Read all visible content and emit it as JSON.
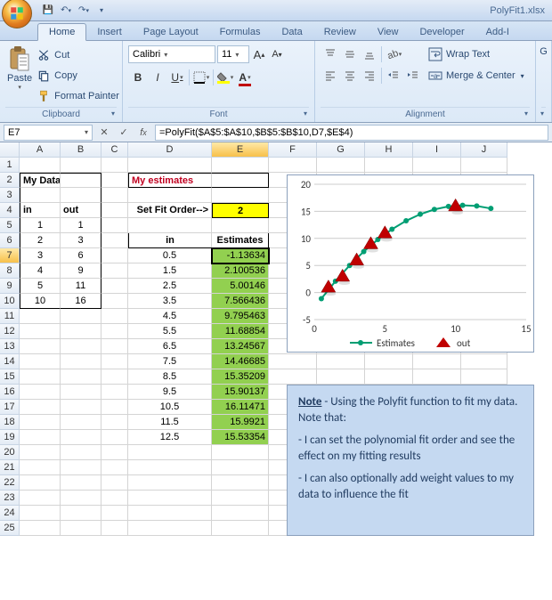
{
  "window": {
    "title": "PolyFit1.xlsx"
  },
  "qat": {
    "save": "💾",
    "undo": "↶",
    "redo": "↷"
  },
  "tabs": [
    "Home",
    "Insert",
    "Page Layout",
    "Formulas",
    "Data",
    "Review",
    "View",
    "Developer",
    "Add-I"
  ],
  "ribbon": {
    "clipboard": {
      "paste": "Paste",
      "cut": "Cut",
      "copy": "Copy",
      "format_painter": "Format Painter",
      "label": "Clipboard"
    },
    "font": {
      "name": "Calibri",
      "size": "11",
      "bold": "B",
      "italic": "I",
      "underline": "U",
      "grow": "A",
      "shrink": "A",
      "label": "Font"
    },
    "alignment": {
      "wrap": "Wrap Text",
      "merge": "Merge & Center",
      "label": "Alignment"
    }
  },
  "namebox": "E7",
  "formula": "=PolyFit($A$5:$A$10,$B$5:$B$10,D7,$E$4)",
  "columns": [
    "A",
    "B",
    "C",
    "D",
    "E",
    "F",
    "G",
    "H",
    "I",
    "J"
  ],
  "rows_shown": 25,
  "labels": {
    "my_data": "My Data",
    "my_estimates": "My estimates",
    "set_fit_order": "Set Fit Order-->",
    "in": "in",
    "out": "out",
    "in2": "in",
    "estimates": "Estimates"
  },
  "fit_order": "2",
  "data_in": [
    "1",
    "2",
    "3",
    "4",
    "5",
    "10"
  ],
  "data_out": [
    "1",
    "3",
    "6",
    "9",
    "11",
    "16"
  ],
  "est_in": [
    "0.5",
    "1.5",
    "2.5",
    "3.5",
    "4.5",
    "5.5",
    "6.5",
    "7.5",
    "8.5",
    "9.5",
    "10.5",
    "11.5",
    "12.5"
  ],
  "est_val": [
    "-1.13634",
    "2.100536",
    "5.00146",
    "7.566436",
    "9.795463",
    "11.68854",
    "13.24567",
    "14.46685",
    "15.35209",
    "15.90137",
    "16.11471",
    "15.9921",
    "15.53354"
  ],
  "note": {
    "title": "Note",
    "line1": " - Using the Polyfit function to fit my data.  Note that:",
    "line2": "- I can set the polynomial fit order and see the effect on my fitting results",
    "line3": "- I can also optionally add weight values to my data to influence the fit"
  },
  "chart_data": {
    "type": "line+scatter",
    "title": "",
    "xlabel": "",
    "ylabel": "",
    "xlim": [
      0,
      15
    ],
    "ylim": [
      -5,
      20
    ],
    "yticks": [
      -5,
      0,
      5,
      10,
      15,
      20
    ],
    "xticks": [
      0,
      5,
      10,
      15
    ],
    "series": [
      {
        "name": "Estimates",
        "type": "line-markers",
        "color": "#009e73",
        "x": [
          0.5,
          1.5,
          2.5,
          3.5,
          4.5,
          5.5,
          6.5,
          7.5,
          8.5,
          9.5,
          10.5,
          11.5,
          12.5
        ],
        "y": [
          -1.14,
          2.1,
          5.0,
          7.57,
          9.8,
          11.69,
          13.25,
          14.47,
          15.35,
          15.9,
          16.11,
          15.99,
          15.53
        ]
      },
      {
        "name": "out",
        "type": "scatter",
        "marker": "triangle",
        "color": "#c00000",
        "x": [
          1,
          2,
          3,
          4,
          5,
          10
        ],
        "y": [
          1,
          3,
          6,
          9,
          11,
          16
        ]
      }
    ],
    "legend": {
      "position": "bottom",
      "items": [
        "Estimates",
        "out"
      ]
    }
  }
}
